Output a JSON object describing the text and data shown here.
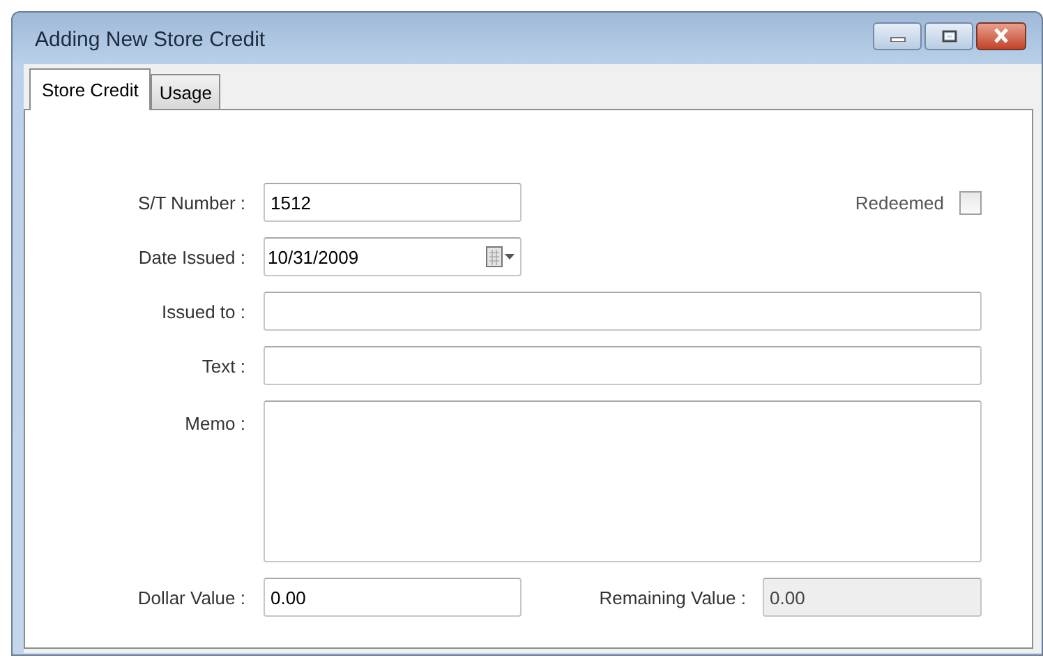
{
  "window": {
    "title": "Adding New Store Credit"
  },
  "tabs": [
    {
      "label": "Store Credit",
      "selected": true
    },
    {
      "label": "Usage",
      "selected": false
    }
  ],
  "form": {
    "st_number": {
      "label": "S/T Number :",
      "value": "1512"
    },
    "redeemed": {
      "label": "Redeemed",
      "checked": false
    },
    "date_issued": {
      "label": "Date Issued :",
      "value": "10/31/2009"
    },
    "issued_to": {
      "label": "Issued to :"
    },
    "text": {
      "label": "Text :"
    },
    "memo": {
      "label": "Memo :"
    },
    "dollar_value": {
      "label": "Dollar Value :",
      "value": "0.00"
    },
    "remaining_value": {
      "label": "Remaining Value :",
      "value": "0.00",
      "disabled": true
    }
  }
}
